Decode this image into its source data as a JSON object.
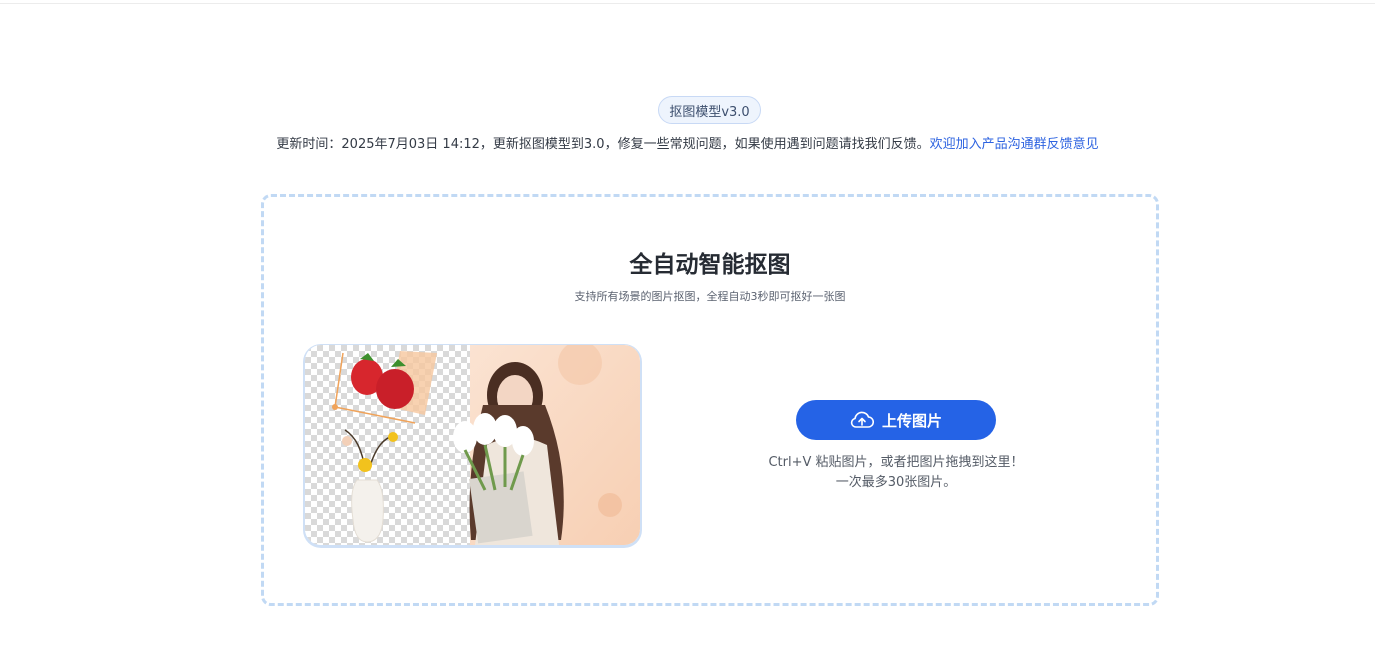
{
  "header": {
    "model_badge": "抠图模型v3.0",
    "update_note": "更新时间：2025年7月03日 14:12，更新抠图模型到3.0，修复一些常规问题，如果使用遇到问题请找我们反馈。",
    "feedback_link": "欢迎加入产品沟通群反馈意见"
  },
  "upload_panel": {
    "title": "全自动智能抠图",
    "subtitle": "支持所有场景的图片抠图，全程自动3秒即可抠好一张图",
    "upload_button": "上传图片",
    "hint_line1": "Ctrl+V 粘贴图片，或者把图片拖拽到这里！",
    "hint_line2": "一次最多30张图片。"
  },
  "icons": {
    "upload": "cloud-upload-icon"
  },
  "colors": {
    "accent": "#2563e6",
    "dashed_border": "#c1d9f4",
    "link": "#2d63e0"
  }
}
